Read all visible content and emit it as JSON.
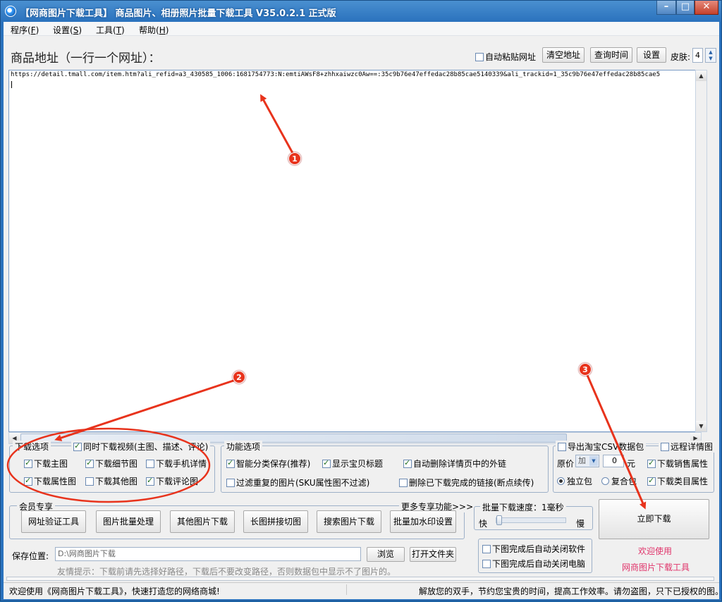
{
  "window": {
    "title": "【网商图片下载工具】 商品图片、相册照片批量下载工具 V35.0.2.1 正式版",
    "minimize_label": "–",
    "maximize_label": "□",
    "close_label": "✕"
  },
  "menu": [
    "程序(F)",
    "设置(S)",
    "工具(T)",
    "帮助(H)"
  ],
  "menu_hotkeys": [
    "F",
    "S",
    "T",
    "H"
  ],
  "menu_names": [
    "程序",
    "设置",
    "工具",
    "帮助"
  ],
  "header": {
    "title": "商品地址（一行一个网址）：",
    "auto_paste_label": "自动粘贴网址",
    "auto_paste_checked": false,
    "clear_button": "清空地址",
    "query_time_button": "查询时间",
    "settings_button": "设置",
    "skin_label": "皮肤:",
    "skin_value": "4"
  },
  "url_input": {
    "value": "https://detail.tmall.com/item.htm?ali_refid=a3_430585_1006:1681754773:N:emtiAWsF8+zhhxaiwzc0Aw==:35c9b76e47effedac28b85cae5140339&ali_trackid=1_35c9b76e47effedac28b85cae5"
  },
  "download_options": {
    "legend": "下载选项",
    "video_label": "同时下载视频(主图、描述、评论)",
    "video_checked": true,
    "items": [
      {
        "label": "下载主图",
        "checked": true
      },
      {
        "label": "下载细节图",
        "checked": true
      },
      {
        "label": "下载手机详情",
        "checked": false
      },
      {
        "label": "下载属性图",
        "checked": true
      },
      {
        "label": "下载其他图",
        "checked": false
      },
      {
        "label": "下载评论图",
        "checked": true
      }
    ]
  },
  "function_options": {
    "legend": "功能选项",
    "items": [
      {
        "label": "智能分类保存(推荐)",
        "checked": true
      },
      {
        "label": "显示宝贝标题",
        "checked": true
      },
      {
        "label": "自动删除详情页中的外链",
        "checked": true
      },
      {
        "label": "过滤重复的图片(SKU属性图不过滤)",
        "checked": false
      },
      {
        "label": "删除已下载完成的链接(断点续传)",
        "checked": false
      }
    ]
  },
  "csv_options": {
    "export_label": "导出淘宝CSV数据包",
    "export_checked": false,
    "remote_detail_label": "远程详情图",
    "remote_detail_checked": false,
    "price_label": "原价",
    "price_op": "加",
    "price_value": "0",
    "price_unit": "元",
    "sales_attr_label": "下载销售属性",
    "sales_attr_checked": true,
    "package_single": "独立包",
    "package_single_selected": true,
    "package_multi": "复合包",
    "package_multi_selected": false,
    "category_attr_label": "下载类目属性",
    "category_attr_checked": true
  },
  "member": {
    "legend": "会员专享",
    "more_link": "更多专享功能>>>",
    "buttons": [
      "网址验证工具",
      "图片批量处理",
      "其他图片下载",
      "长图拼接切图",
      "搜索图片下载",
      "批量加水印设置"
    ]
  },
  "speed": {
    "legend": "批量下载速度：1毫秒",
    "fast_label": "快",
    "slow_label": "慢",
    "level": 0.0
  },
  "after_download": [
    {
      "label": "下图完成后自动关闭软件",
      "checked": false
    },
    {
      "label": "下图完成后自动关闭电脑",
      "checked": false
    }
  ],
  "download_button": "立即下载",
  "welcome": {
    "line1": "欢迎使用",
    "line2": "网商图片下载工具"
  },
  "save": {
    "label": "保存位置:",
    "path": "D:\\网商图片下载",
    "browse_button": "浏览",
    "open_folder_button": "打开文件夹",
    "hint": "友情提示：下载前请先选择好路径，下载后不要改变路径，否则数据包中显示不了图片的。"
  },
  "status": {
    "left": "欢迎使用《网商图片下载工具》，快速打造您的网络商城!",
    "right": "解放您的双手，节约您宝贵的时间，提高工作效率。请勿盗图，只下已授权的图。"
  },
  "annotations": [
    "1",
    "2",
    "3"
  ],
  "colors": {
    "annotation_red": "#e8331c",
    "welcome_pink": "#e0336a",
    "title_blue": "#2a72bd"
  }
}
